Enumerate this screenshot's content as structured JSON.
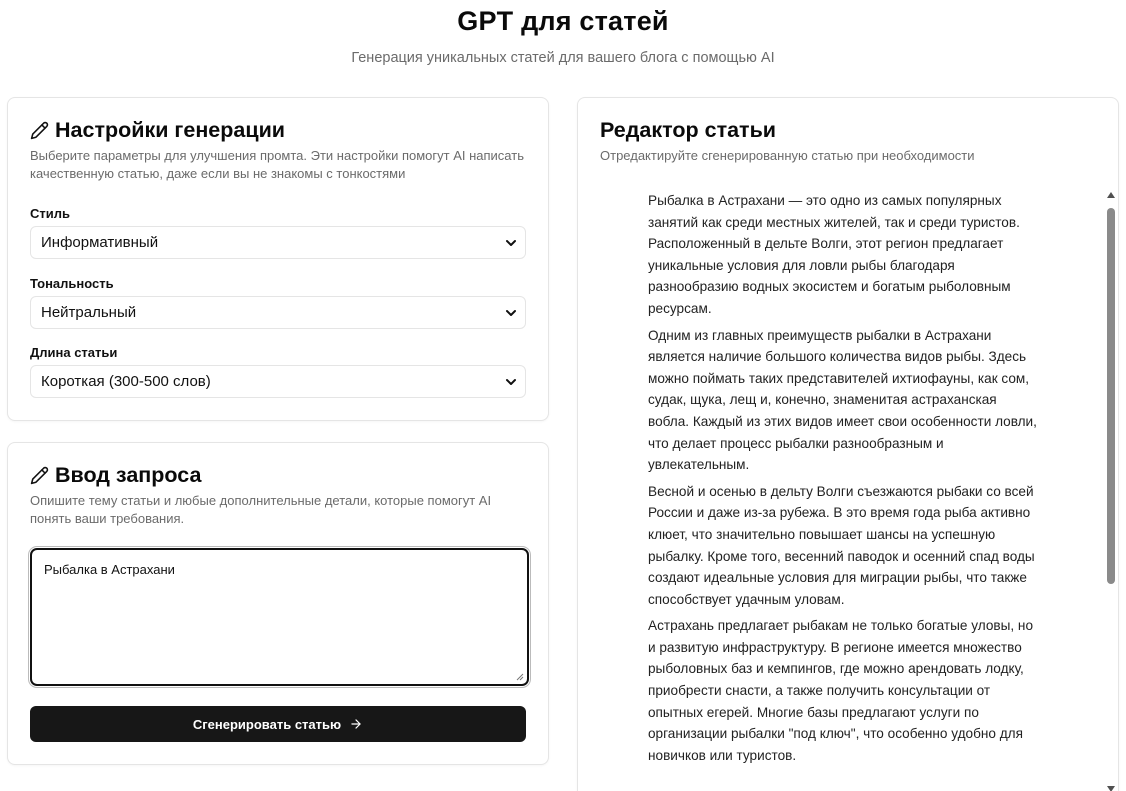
{
  "header": {
    "title": "GPT для статей",
    "subtitle": "Генерация уникальных статей для вашего блога с помощью AI"
  },
  "settings": {
    "title": "Настройки генерации",
    "description": "Выберите параметры для улучшения промта. Эти настройки помогут AI написать качественную статью, даже если вы не знакомы с тонкостями",
    "style_label": "Стиль",
    "style_value": "Информативный",
    "tone_label": "Тональность",
    "tone_value": "Нейтральный",
    "length_label": "Длина статьи",
    "length_value": "Короткая (300-500 слов)"
  },
  "prompt": {
    "title": "Ввод запроса",
    "description": "Опишите тему статьи и любые дополнительные детали, которые помогут AI понять ваши требования.",
    "input_value": "Рыбалка в Астрахани",
    "generate_label": "Сгенерировать статью"
  },
  "editor": {
    "title": "Редактор статьи",
    "description": "Отредактируйте сгенерированную статью при необходимости",
    "paragraphs": [
      "Рыбалка в Астрахани — это одно из самых популярных занятий как среди местных жителей, так и среди туристов. Расположенный в дельте Волги, этот регион предлагает уникальные условия для ловли рыбы благодаря разнообразию водных экосистем и богатым рыболовным ресурсам.",
      "Одним из главных преимуществ рыбалки в Астрахани является наличие большого количества видов рыбы. Здесь можно поймать таких представителей ихтиофауны, как сом, судак, щука, лещ и, конечно, знаменитая астраханская вобла. Каждый из этих видов имеет свои особенности ловли, что делает процесс рыбалки разнообразным и увлекательным.",
      "Весной и осенью в дельту Волги съезжаются рыбаки со всей России и даже из-за рубежа. В это время года рыба активно клюет, что значительно повышает шансы на успешную рыбалку. Кроме того, весенний паводок и осенний спад воды создают идеальные условия для миграции рыбы, что также способствует удачным уловам.",
      "Астрахань предлагает рыбакам не только богатые уловы, но и развитую инфраструктуру. В регионе имеется множество рыболовных баз и кемпингов, где можно арендовать лодку, приобрести снасти, а также получить консультации от опытных егерей. Многие базы предлагают услуги по организации рыбалки \"под ключ\", что особенно удобно для новичков или туристов."
    ]
  },
  "icons": {
    "settings_title_icon": "pencil-icon",
    "prompt_title_icon": "pencil-icon",
    "select_chevron": "chevron-down-icon",
    "button_icon": "arrow-right-icon"
  }
}
